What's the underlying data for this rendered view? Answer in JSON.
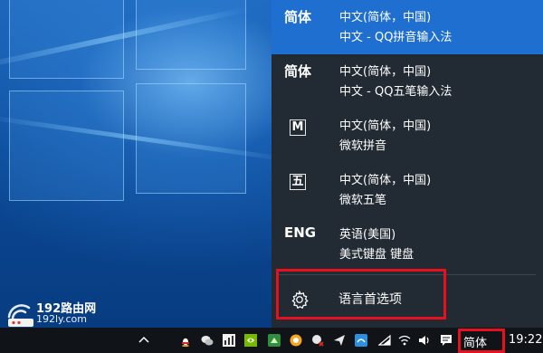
{
  "ime_menu": {
    "items": [
      {
        "short": "简体",
        "icon": null,
        "lang": "中文(简体，中国)",
        "name": "中文 - QQ拼音输入法",
        "active": true
      },
      {
        "short": "简体",
        "icon": null,
        "lang": "中文(简体，中国)",
        "name": "中文 - QQ五笔输入法",
        "active": false
      },
      {
        "short": "",
        "icon": "M",
        "lang": "中文(简体，中国)",
        "name": "微软拼音",
        "active": false
      },
      {
        "short": "",
        "icon": "五",
        "lang": "中文(简体，中国)",
        "name": "微软五笔",
        "active": false
      },
      {
        "short": "ENG",
        "icon": null,
        "lang": "英语(美国)",
        "name": "美式键盘 键盘",
        "active": false
      }
    ],
    "preferences_label": "语言首选项",
    "highlight_color": "#e8101c",
    "active_color": "#1e6fd0"
  },
  "taskbar": {
    "input_indicator": "简体",
    "clock": "19:22",
    "tray_icons": [
      "chevron-up-icon",
      "qq-penguin-icon",
      "wechat-icon",
      "chart-icon",
      "nvidia-icon",
      "green-app-icon",
      "orange-circle-icon",
      "muted-app-icon",
      "send-icon",
      "network-app-icon",
      "wifi-icon",
      "speaker-icon",
      "action-center-icon"
    ]
  },
  "watermark": {
    "title": "192路由网",
    "url": "192ly.com"
  }
}
